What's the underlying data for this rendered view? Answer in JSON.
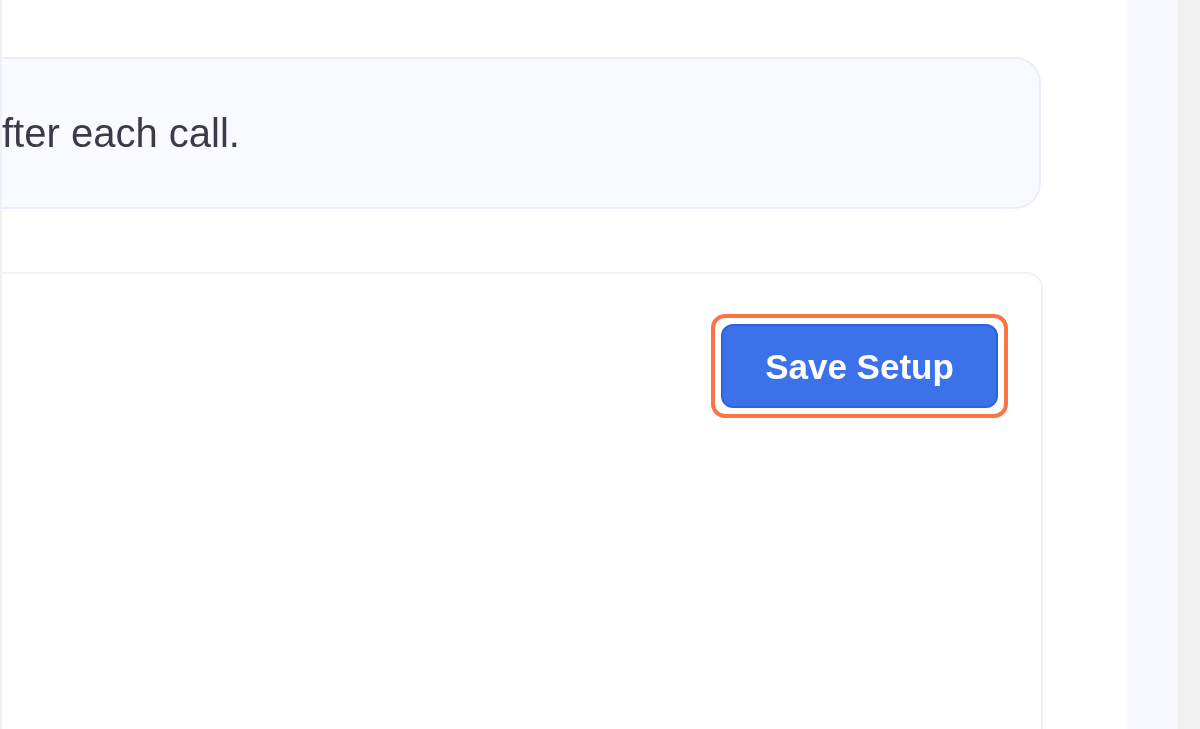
{
  "notice": {
    "text": "fter each call."
  },
  "setup_panel": {
    "save_button": {
      "label": "Save Setup",
      "highlighted": true
    }
  }
}
